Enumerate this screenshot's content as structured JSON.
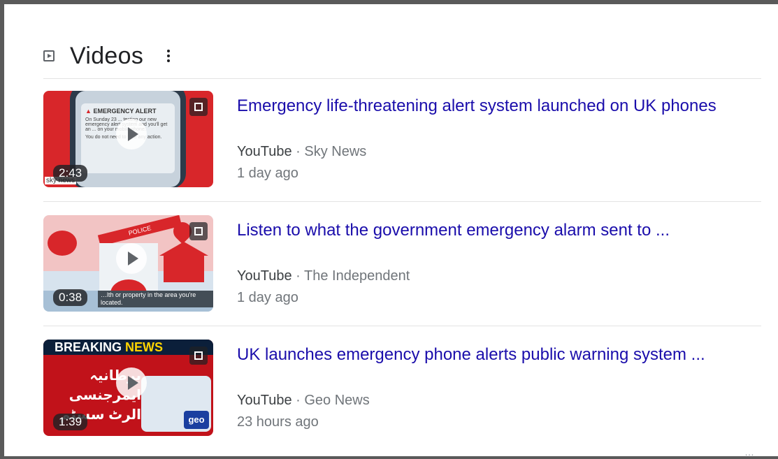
{
  "section": {
    "title": "Videos",
    "icon": "play-box-icon",
    "menu_icon": "more-vert-icon"
  },
  "videos": [
    {
      "title": "Emergency life-threatening alert system launched on UK phones",
      "platform": "YouTube",
      "separator": " · ",
      "channel": "Sky News",
      "date": "1 day ago",
      "duration": "2:43",
      "thumb": {
        "alert_heading": "EMERGENCY ALERT",
        "alert_body": "On Sunday 23 ... testing our new emergency alert system and you'll get an ... on your mobile phone.",
        "alert_footer": "You do not need to take any action.",
        "logo_text": "sky news"
      }
    },
    {
      "title": "Listen to what the government emergency alarm sent to ...",
      "platform": "YouTube",
      "separator": " · ",
      "channel": "The Independent",
      "date": "1 day ago",
      "duration": "0:38",
      "thumb": {
        "tape_text": "POLICE",
        "caption": "…lth or property in the area you're located."
      }
    },
    {
      "title": "UK launches emergency phone alerts public warning system ...",
      "platform": "YouTube",
      "separator": " · ",
      "channel": "Geo News",
      "date": "23 hours ago",
      "duration": "1:39",
      "thumb": {
        "banner_word1": "BREAKING",
        "banner_word2": "NEWS",
        "urdu_text": "برطانیہ ایمرجنسی الرٹ سسٹم",
        "geo_logo": "geo"
      }
    }
  ],
  "footer": {
    "see_all": "…"
  },
  "colors": {
    "link": "#1a0dab",
    "meta": "#70757a",
    "alert_red": "#d8262a"
  }
}
